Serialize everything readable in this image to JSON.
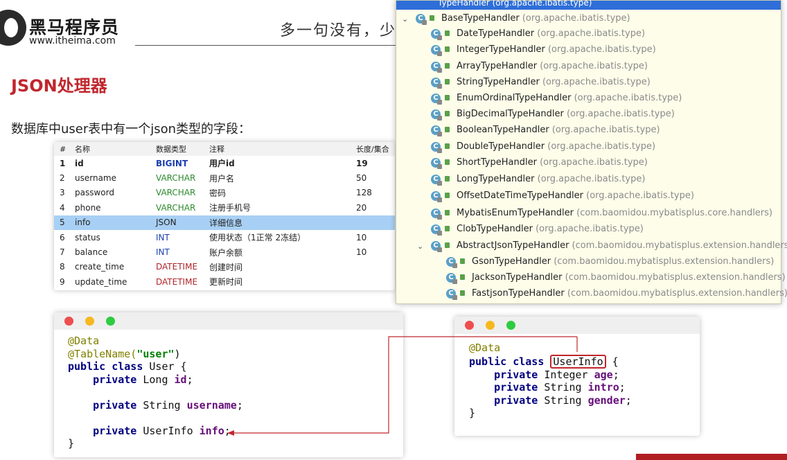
{
  "header": {
    "brand": "黑马程序员",
    "url": "www.itheima.com",
    "slogan": "多一句没有，少"
  },
  "page_title": "JSON处理器",
  "description": "数据库中user表中有一个json类型的字段：",
  "db_table": {
    "columns": [
      "#",
      "名称",
      "数据类型",
      "注释",
      "长度/集合"
    ],
    "rows": [
      {
        "n": "1",
        "name": "id",
        "type": "BIGINT",
        "comment": "用户id",
        "len": "19"
      },
      {
        "n": "2",
        "name": "username",
        "type": "VARCHAR",
        "comment": "用户名",
        "len": "50"
      },
      {
        "n": "3",
        "name": "password",
        "type": "VARCHAR",
        "comment": "密码",
        "len": "128"
      },
      {
        "n": "4",
        "name": "phone",
        "type": "VARCHAR",
        "comment": "注册手机号",
        "len": "20"
      },
      {
        "n": "5",
        "name": "info",
        "type": "JSON",
        "comment": "详细信息",
        "len": ""
      },
      {
        "n": "6",
        "name": "status",
        "type": "INT",
        "comment": "使用状态（1正常 2冻结）",
        "len": "10"
      },
      {
        "n": "7",
        "name": "balance",
        "type": "INT",
        "comment": "账户余额",
        "len": "10"
      },
      {
        "n": "8",
        "name": "create_time",
        "type": "DATETIME",
        "comment": "创建时间",
        "len": ""
      },
      {
        "n": "9",
        "name": "update_time",
        "type": "DATETIME",
        "comment": "更新时间",
        "len": ""
      }
    ]
  },
  "user_code": {
    "ann_data": "@Data",
    "ann_table": "@TableName(",
    "table_str": "\"user\"",
    "close_paren": ")",
    "kw_public_class": "public class",
    "class_name": " User {",
    "kw_private": "private",
    "t_long": " Long ",
    "f_id": "id",
    "t_string": " String ",
    "f_username": "username",
    "t_userinfo": " UserInfo ",
    "f_info": "info",
    "semi": ";",
    "close": "}"
  },
  "userinfo_code": {
    "ann_data": "@Data",
    "kw_public_class": "public class",
    "class_name": "UserInfo",
    "open": " {",
    "kw_private": "private",
    "t_integer": " Integer ",
    "f_age": "age",
    "t_string": " String ",
    "f_intro": "intro",
    "f_gender": "gender",
    "semi": ";",
    "close": "}"
  },
  "type_popup": {
    "header": "TypeHandler (org.apache.ibatis.type)",
    "items": [
      {
        "name": "BaseTypeHandler",
        "pkg": " (org.apache.ibatis.type)"
      },
      {
        "name": "DateTypeHandler",
        "pkg": " (org.apache.ibatis.type)"
      },
      {
        "name": "IntegerTypeHandler",
        "pkg": " (org.apache.ibatis.type)"
      },
      {
        "name": "ArrayTypeHandler",
        "pkg": " (org.apache.ibatis.type)"
      },
      {
        "name": "StringTypeHandler",
        "pkg": " (org.apache.ibatis.type)"
      },
      {
        "name": "EnumOrdinalTypeHandler",
        "pkg": " (org.apache.ibatis.type)"
      },
      {
        "name": "BigDecimalTypeHandler",
        "pkg": " (org.apache.ibatis.type)"
      },
      {
        "name": "BooleanTypeHandler",
        "pkg": " (org.apache.ibatis.type)"
      },
      {
        "name": "DoubleTypeHandler",
        "pkg": " (org.apache.ibatis.type)"
      },
      {
        "name": "ShortTypeHandler",
        "pkg": " (org.apache.ibatis.type)"
      },
      {
        "name": "LongTypeHandler",
        "pkg": " (org.apache.ibatis.type)"
      },
      {
        "name": "OffsetDateTimeTypeHandler",
        "pkg": " (org.apache.ibatis.type)"
      },
      {
        "name": "MybatisEnumTypeHandler",
        "pkg": " (com.baomidou.mybatisplus.core.handlers)"
      },
      {
        "name": "ClobTypeHandler",
        "pkg": " (org.apache.ibatis.type)"
      },
      {
        "name": "AbstractJsonTypeHandler",
        "pkg": " (com.baomidou.mybatisplus.extension.handlers)"
      },
      {
        "name": "GsonTypeHandler",
        "pkg": " (com.baomidou.mybatisplus.extension.handlers)"
      },
      {
        "name": "JacksonTypeHandler",
        "pkg": " (com.baomidou.mybatisplus.extension.handlers)"
      },
      {
        "name": "FastjsonTypeHandler",
        "pkg": " (com.baomidou.mybatisplus.extension.handlers)"
      }
    ]
  },
  "colors": {
    "accent_red": "#c0272d",
    "selection_blue": "#a8d0f5",
    "popup_bg": "#fdfdea"
  }
}
